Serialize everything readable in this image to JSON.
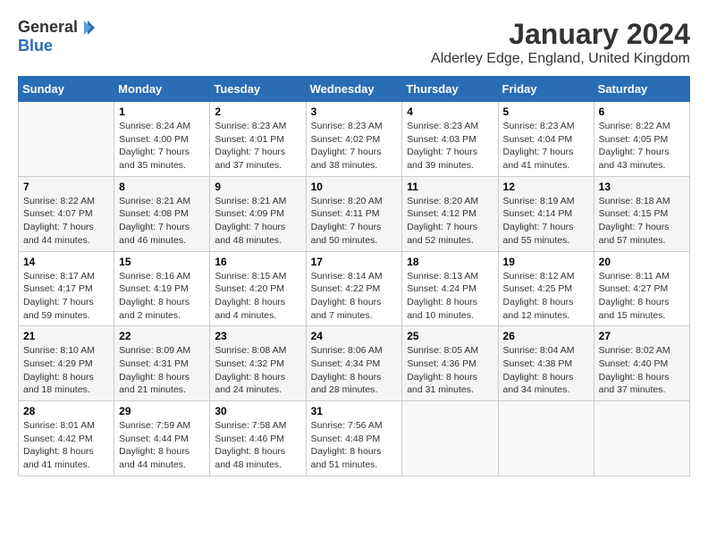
{
  "header": {
    "logo_general": "General",
    "logo_blue": "Blue",
    "month_year": "January 2024",
    "location": "Alderley Edge, England, United Kingdom"
  },
  "calendar": {
    "days_of_week": [
      "Sunday",
      "Monday",
      "Tuesday",
      "Wednesday",
      "Thursday",
      "Friday",
      "Saturday"
    ],
    "weeks": [
      [
        {
          "day": "",
          "info": ""
        },
        {
          "day": "1",
          "info": "Sunrise: 8:24 AM\nSunset: 4:00 PM\nDaylight: 7 hours\nand 35 minutes."
        },
        {
          "day": "2",
          "info": "Sunrise: 8:23 AM\nSunset: 4:01 PM\nDaylight: 7 hours\nand 37 minutes."
        },
        {
          "day": "3",
          "info": "Sunrise: 8:23 AM\nSunset: 4:02 PM\nDaylight: 7 hours\nand 38 minutes."
        },
        {
          "day": "4",
          "info": "Sunrise: 8:23 AM\nSunset: 4:03 PM\nDaylight: 7 hours\nand 39 minutes."
        },
        {
          "day": "5",
          "info": "Sunrise: 8:23 AM\nSunset: 4:04 PM\nDaylight: 7 hours\nand 41 minutes."
        },
        {
          "day": "6",
          "info": "Sunrise: 8:22 AM\nSunset: 4:05 PM\nDaylight: 7 hours\nand 43 minutes."
        }
      ],
      [
        {
          "day": "7",
          "info": "Sunrise: 8:22 AM\nSunset: 4:07 PM\nDaylight: 7 hours\nand 44 minutes."
        },
        {
          "day": "8",
          "info": "Sunrise: 8:21 AM\nSunset: 4:08 PM\nDaylight: 7 hours\nand 46 minutes."
        },
        {
          "day": "9",
          "info": "Sunrise: 8:21 AM\nSunset: 4:09 PM\nDaylight: 7 hours\nand 48 minutes."
        },
        {
          "day": "10",
          "info": "Sunrise: 8:20 AM\nSunset: 4:11 PM\nDaylight: 7 hours\nand 50 minutes."
        },
        {
          "day": "11",
          "info": "Sunrise: 8:20 AM\nSunset: 4:12 PM\nDaylight: 7 hours\nand 52 minutes."
        },
        {
          "day": "12",
          "info": "Sunrise: 8:19 AM\nSunset: 4:14 PM\nDaylight: 7 hours\nand 55 minutes."
        },
        {
          "day": "13",
          "info": "Sunrise: 8:18 AM\nSunset: 4:15 PM\nDaylight: 7 hours\nand 57 minutes."
        }
      ],
      [
        {
          "day": "14",
          "info": "Sunrise: 8:17 AM\nSunset: 4:17 PM\nDaylight: 7 hours\nand 59 minutes."
        },
        {
          "day": "15",
          "info": "Sunrise: 8:16 AM\nSunset: 4:19 PM\nDaylight: 8 hours\nand 2 minutes."
        },
        {
          "day": "16",
          "info": "Sunrise: 8:15 AM\nSunset: 4:20 PM\nDaylight: 8 hours\nand 4 minutes."
        },
        {
          "day": "17",
          "info": "Sunrise: 8:14 AM\nSunset: 4:22 PM\nDaylight: 8 hours\nand 7 minutes."
        },
        {
          "day": "18",
          "info": "Sunrise: 8:13 AM\nSunset: 4:24 PM\nDaylight: 8 hours\nand 10 minutes."
        },
        {
          "day": "19",
          "info": "Sunrise: 8:12 AM\nSunset: 4:25 PM\nDaylight: 8 hours\nand 12 minutes."
        },
        {
          "day": "20",
          "info": "Sunrise: 8:11 AM\nSunset: 4:27 PM\nDaylight: 8 hours\nand 15 minutes."
        }
      ],
      [
        {
          "day": "21",
          "info": "Sunrise: 8:10 AM\nSunset: 4:29 PM\nDaylight: 8 hours\nand 18 minutes."
        },
        {
          "day": "22",
          "info": "Sunrise: 8:09 AM\nSunset: 4:31 PM\nDaylight: 8 hours\nand 21 minutes."
        },
        {
          "day": "23",
          "info": "Sunrise: 8:08 AM\nSunset: 4:32 PM\nDaylight: 8 hours\nand 24 minutes."
        },
        {
          "day": "24",
          "info": "Sunrise: 8:06 AM\nSunset: 4:34 PM\nDaylight: 8 hours\nand 28 minutes."
        },
        {
          "day": "25",
          "info": "Sunrise: 8:05 AM\nSunset: 4:36 PM\nDaylight: 8 hours\nand 31 minutes."
        },
        {
          "day": "26",
          "info": "Sunrise: 8:04 AM\nSunset: 4:38 PM\nDaylight: 8 hours\nand 34 minutes."
        },
        {
          "day": "27",
          "info": "Sunrise: 8:02 AM\nSunset: 4:40 PM\nDaylight: 8 hours\nand 37 minutes."
        }
      ],
      [
        {
          "day": "28",
          "info": "Sunrise: 8:01 AM\nSunset: 4:42 PM\nDaylight: 8 hours\nand 41 minutes."
        },
        {
          "day": "29",
          "info": "Sunrise: 7:59 AM\nSunset: 4:44 PM\nDaylight: 8 hours\nand 44 minutes."
        },
        {
          "day": "30",
          "info": "Sunrise: 7:58 AM\nSunset: 4:46 PM\nDaylight: 8 hours\nand 48 minutes."
        },
        {
          "day": "31",
          "info": "Sunrise: 7:56 AM\nSunset: 4:48 PM\nDaylight: 8 hours\nand 51 minutes."
        },
        {
          "day": "",
          "info": ""
        },
        {
          "day": "",
          "info": ""
        },
        {
          "day": "",
          "info": ""
        }
      ]
    ]
  }
}
